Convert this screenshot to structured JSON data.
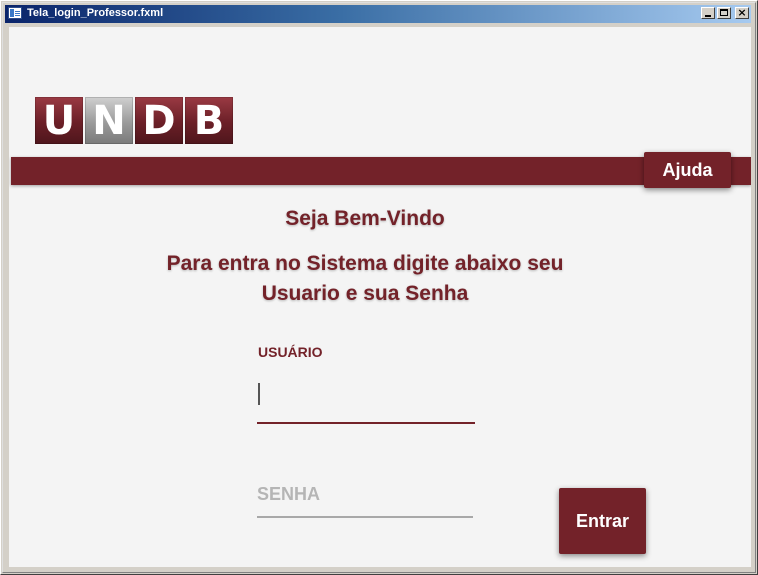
{
  "window": {
    "title": "Tela_login_Professor.fxml",
    "controls": {
      "minimize_icon": "minimize-icon",
      "maximize_icon": "maximize-icon",
      "close_icon": "close-icon",
      "close_glyph": "×"
    }
  },
  "logo": {
    "letters": [
      "U",
      "N",
      "D",
      "B"
    ]
  },
  "header": {
    "help_label": "Ajuda"
  },
  "main": {
    "welcome": "Seja Bem-Vindo",
    "instructions": "Para entra no Sistema digite abaixo seu Usuario e sua Senha"
  },
  "form": {
    "user_label": "USUÁRIO",
    "user_value": "",
    "password_placeholder": "SENHA",
    "password_value": "",
    "submit_label": "Entrar"
  },
  "colors": {
    "brand": "#732229",
    "background": "#f4f4f4",
    "placeholder": "#b5b5b5"
  }
}
